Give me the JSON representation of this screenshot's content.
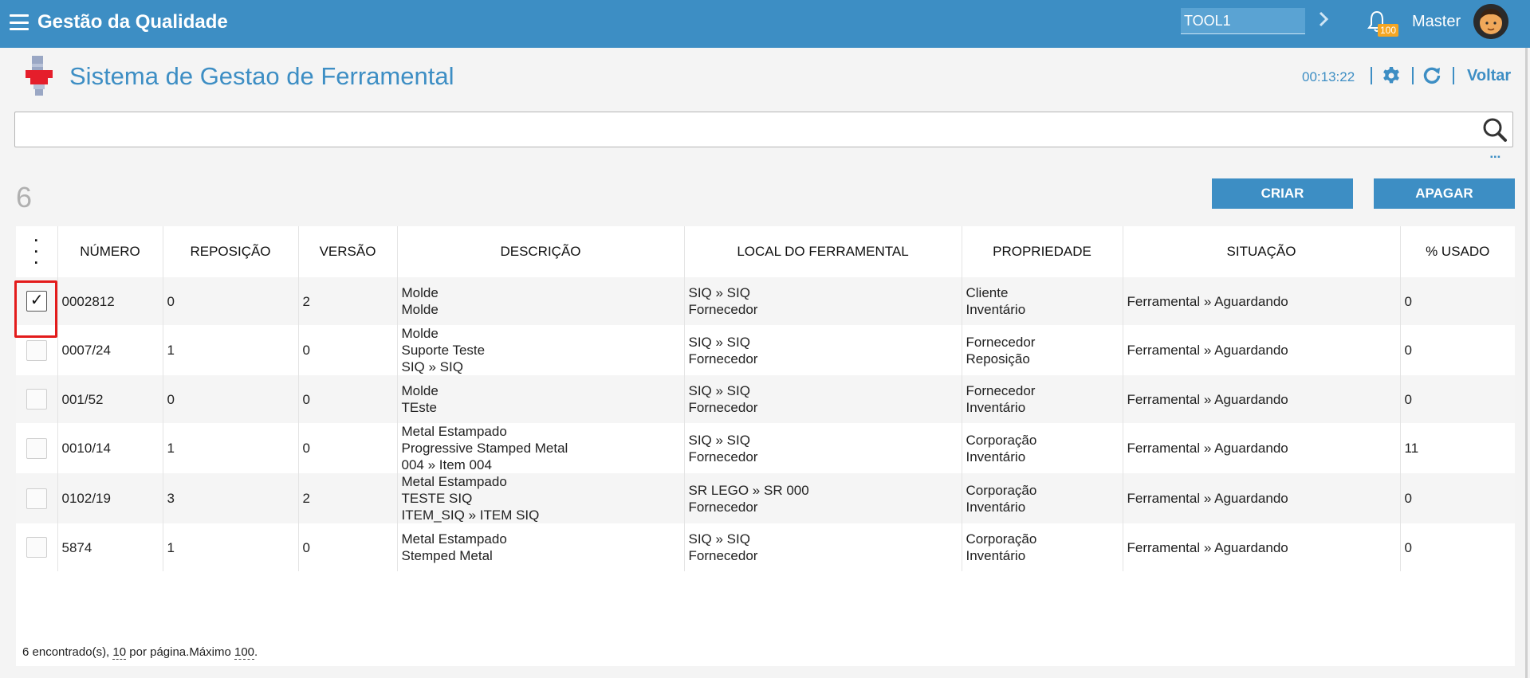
{
  "header": {
    "app_title": "Gestão da Qualidade",
    "tool_value": "TOOL1",
    "notification_count": "100",
    "user_name": "Master"
  },
  "page": {
    "title": "Sistema de Gestao de Ferramental",
    "clock": "00:13:22",
    "back_label": "Voltar"
  },
  "search": {
    "value": ""
  },
  "toolbar": {
    "result_count": "6",
    "create_label": "CRIAR",
    "delete_label": "APAGAR"
  },
  "table": {
    "columns": [
      "NÚMERO",
      "REPOSIÇÃO",
      "VERSÃO",
      "DESCRIÇÃO",
      "LOCAL DO FERRAMENTAL",
      "PROPRIEDADE",
      "SITUAÇÃO",
      "% USADO"
    ],
    "rows": [
      {
        "checked": true,
        "numero": "0002812",
        "reposicao": "0",
        "versao": "2",
        "descricao": [
          "Molde",
          "Molde"
        ],
        "local": [
          "SIQ » SIQ",
          "Fornecedor"
        ],
        "propriedade": [
          "Cliente",
          "Inventário"
        ],
        "situacao": "Ferramental » Aguardando",
        "usado": "0"
      },
      {
        "checked": false,
        "numero": "0007/24",
        "reposicao": "1",
        "versao": "0",
        "descricao": [
          "Molde",
          "Suporte Teste",
          "SIQ » SIQ"
        ],
        "local": [
          "SIQ » SIQ",
          "Fornecedor"
        ],
        "propriedade": [
          "Fornecedor",
          "Reposição"
        ],
        "situacao": "Ferramental » Aguardando",
        "usado": "0"
      },
      {
        "checked": false,
        "numero": "001/52",
        "reposicao": "0",
        "versao": "0",
        "descricao": [
          "Molde",
          "TEste"
        ],
        "local": [
          "SIQ » SIQ",
          "Fornecedor"
        ],
        "propriedade": [
          "Fornecedor",
          "Inventário"
        ],
        "situacao": "Ferramental » Aguardando",
        "usado": "0"
      },
      {
        "checked": false,
        "numero": "0010/14",
        "reposicao": "1",
        "versao": "0",
        "descricao": [
          "Metal Estampado",
          "Progressive Stamped Metal",
          "004 » Item 004"
        ],
        "local": [
          "SIQ » SIQ",
          "Fornecedor"
        ],
        "propriedade": [
          "Corporação",
          "Inventário"
        ],
        "situacao": "Ferramental » Aguardando",
        "usado": "11"
      },
      {
        "checked": false,
        "numero": "0102/19",
        "reposicao": "3",
        "versao": "2",
        "descricao": [
          "Metal Estampado",
          "TESTE SIQ",
          "ITEM_SIQ » ITEM SIQ"
        ],
        "local": [
          "SR LEGO » SR 000",
          "Fornecedor"
        ],
        "propriedade": [
          "Corporação",
          "Inventário"
        ],
        "situacao": "Ferramental » Aguardando",
        "usado": "0"
      },
      {
        "checked": false,
        "numero": "5874",
        "reposicao": "1",
        "versao": "0",
        "descricao": [
          "Metal Estampado",
          "Stemped Metal"
        ],
        "local": [
          "SIQ » SIQ",
          "Fornecedor"
        ],
        "propriedade": [
          "Corporação",
          "Inventário"
        ],
        "situacao": "Ferramental » Aguardando",
        "usado": "0"
      }
    ]
  },
  "footer": {
    "found_text": "6 encontrado(s), ",
    "per_page": "10",
    "per_page_text": " por página.Máximo ",
    "max": "100",
    "end": "."
  },
  "colors": {
    "primary": "#3d8ec4",
    "highlight": "#e31b1b",
    "badge": "#f5a623"
  },
  "icons": [
    "menu-icon",
    "chevron-right-icon",
    "bell-icon",
    "avatar",
    "tool-logo-icon",
    "gear-icon",
    "refresh-icon",
    "search-icon",
    "more-icon",
    "column-menu-icon",
    "checkbox"
  ]
}
